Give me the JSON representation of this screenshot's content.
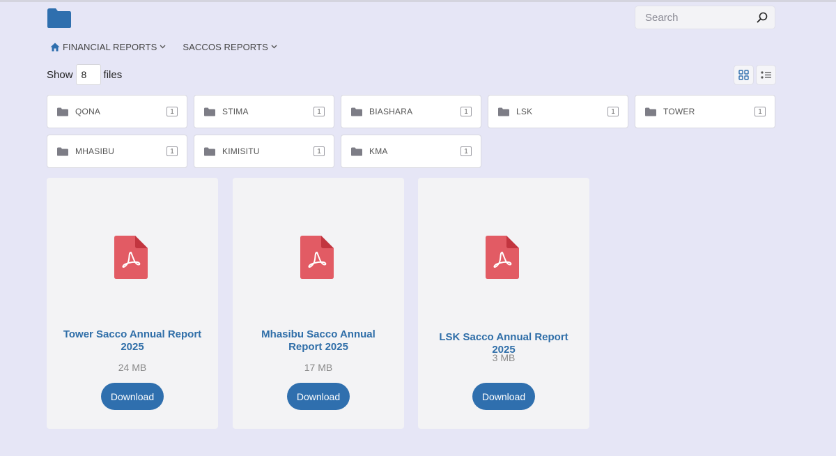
{
  "search": {
    "placeholder": "Search"
  },
  "breadcrumb": [
    {
      "label": "FINANCIAL REPORTS"
    },
    {
      "label": "SACCOS REPORTS"
    }
  ],
  "show_files": {
    "prefix": "Show",
    "value": "8",
    "suffix": "files"
  },
  "folders": [
    {
      "name": "QONA",
      "count": "1"
    },
    {
      "name": "STIMA",
      "count": "1"
    },
    {
      "name": "BIASHARA",
      "count": "1"
    },
    {
      "name": "LSK",
      "count": "1"
    },
    {
      "name": "TOWER",
      "count": "1"
    },
    {
      "name": "MHASIBU",
      "count": "1"
    },
    {
      "name": "KIMISITU",
      "count": "1"
    },
    {
      "name": "KMA",
      "count": "1"
    }
  ],
  "files": [
    {
      "title": "Tower Sacco Annual Report 2025",
      "size": "24 MB",
      "download_label": "Download"
    },
    {
      "title": "Mhasibu Sacco Annual Report 2025",
      "size": "17 MB",
      "download_label": "Download"
    },
    {
      "title": "LSK Sacco Annual Report 2025",
      "size": "3 MB",
      "download_label": "Download"
    }
  ],
  "colors": {
    "background": "#e6e6f6",
    "accent": "#2f6fae",
    "pdf_red": "#e25b64"
  }
}
